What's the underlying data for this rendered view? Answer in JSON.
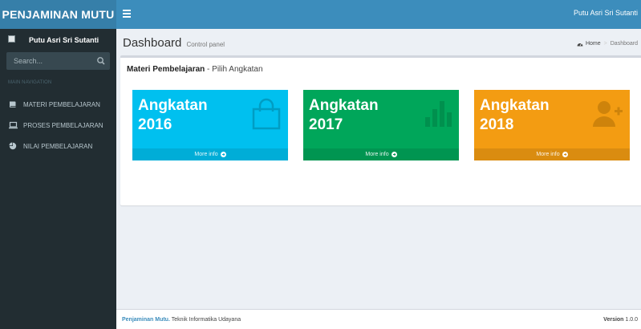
{
  "header": {
    "logo": "PENJAMINAN MUTU",
    "user_name": "Putu Asri Sri Sutanti"
  },
  "sidebar": {
    "user_name": "Putu Asri Sri Sutanti",
    "search_placeholder": "Search...",
    "section_header": "MAIN NAVIGATION",
    "items": [
      {
        "label": "MATERI PEMBELAJARAN",
        "icon": "book-icon"
      },
      {
        "label": "PROSES PEMBELAJARAN",
        "icon": "laptop-icon"
      },
      {
        "label": "NILAI PEMBELAJARAN",
        "icon": "chart-pie-icon"
      }
    ]
  },
  "page": {
    "title": "Dashboard",
    "subtitle": "Control panel",
    "breadcrumb": {
      "home": "Home",
      "current": "Dashboard"
    }
  },
  "box": {
    "title_bold": "Materi Pembelajaran",
    "title_rest": " - Pilih Angkatan"
  },
  "tiles": [
    {
      "line1": "Angkatan",
      "line2": "2016",
      "more": "More info",
      "color": "#00c0ef",
      "footer_color": "#00add7",
      "icon": "shopping-bag-icon"
    },
    {
      "line1": "Angkatan",
      "line2": "2017",
      "more": "More info",
      "color": "#00a65a",
      "footer_color": "#009551",
      "icon": "bar-chart-icon"
    },
    {
      "line1": "Angkatan",
      "line2": "2018",
      "more": "More info",
      "color": "#f39c12",
      "footer_color": "#da8c10",
      "icon": "user-plus-icon"
    }
  ],
  "footer": {
    "brand": "Penjaminan Mutu.",
    "text": " Teknik Informatika Udayana",
    "version_label": "Version",
    "version": "1.0.0"
  }
}
